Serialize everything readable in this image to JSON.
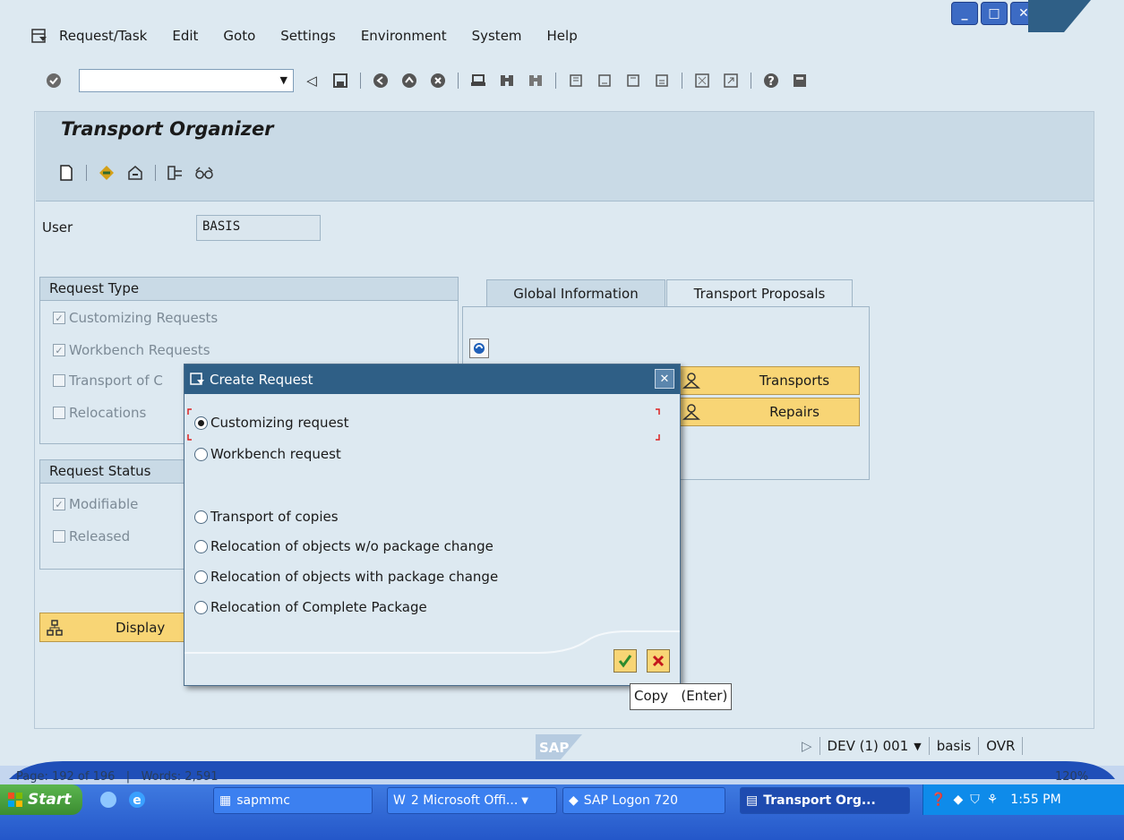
{
  "menubar": {
    "items": [
      "Request/Task",
      "Edit",
      "Goto",
      "Settings",
      "Environment",
      "System",
      "Help"
    ]
  },
  "command_field": {
    "value": ""
  },
  "screen": {
    "title": "Transport Organizer",
    "user_label": "User",
    "user_value": "BASIS"
  },
  "request_type": {
    "title": "Request Type",
    "items": [
      {
        "label": "Customizing Requests",
        "checked": true
      },
      {
        "label": "Workbench Requests",
        "checked": true
      },
      {
        "label": "Transport of C",
        "checked": false
      },
      {
        "label": "Relocations",
        "checked": false
      }
    ]
  },
  "request_status": {
    "title": "Request Status",
    "items": [
      {
        "label": "Modifiable",
        "checked": true
      },
      {
        "label": "Released",
        "checked": false
      }
    ]
  },
  "display_button": {
    "label": "Display"
  },
  "tabs": [
    {
      "label": "Global Information",
      "active": true
    },
    {
      "label": "Transport Proposals",
      "active": false
    }
  ],
  "tab_buttons": {
    "transports": "Transports",
    "repairs": "Repairs"
  },
  "dialog": {
    "title": "Create Request",
    "options": [
      {
        "label": "Customizing request",
        "selected": true
      },
      {
        "label": "Workbench request",
        "selected": false
      },
      {
        "label": "Transport of copies",
        "selected": false
      },
      {
        "label": "Relocation of objects w/o package change",
        "selected": false
      },
      {
        "label": "Relocation of objects with package change",
        "selected": false
      },
      {
        "label": "Relocation of Complete Package",
        "selected": false
      }
    ]
  },
  "tooltip": "Copy   (Enter)",
  "statusbar": {
    "system": "DEV (1) 001",
    "user": "basis",
    "mode": "OVR"
  },
  "word_status": {
    "page": "Page: 192 of 196",
    "words": "Words: 2,591",
    "zoom": "120%"
  },
  "taskbar": {
    "start": "Start",
    "buttons": [
      "sapmmc",
      "2 Microsoft Offi...",
      "SAP Logon 720",
      "Transport Org..."
    ],
    "clock": "1:55 PM"
  },
  "colors": {
    "background": "#dde9f1",
    "title_band": "#c9dae6",
    "dialog_title": "#2f5f86",
    "button_yellow": "#f8d575"
  }
}
